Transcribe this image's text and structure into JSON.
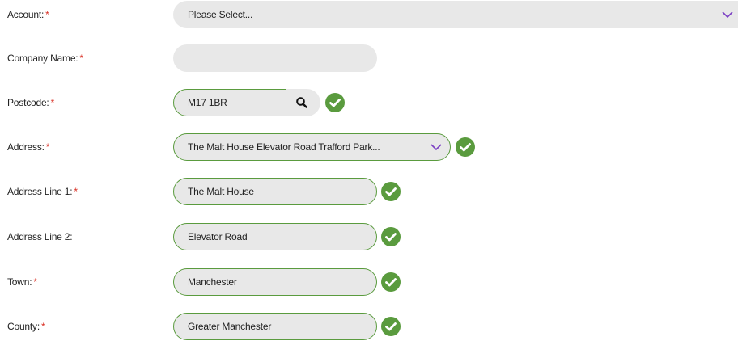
{
  "form": {
    "account": {
      "label": "Account:",
      "required": "*",
      "value": "Please Select..."
    },
    "company_name": {
      "label": "Company Name:",
      "required": "*",
      "value": ""
    },
    "postcode": {
      "label": "Postcode:",
      "required": "*",
      "value": "M17 1BR"
    },
    "address": {
      "label": "Address:",
      "required": "*",
      "value": "The Malt House Elevator Road Trafford Park..."
    },
    "address_line_1": {
      "label": "Address Line 1:",
      "required": "*",
      "value": "The Malt House"
    },
    "address_line_2": {
      "label": "Address Line 2:",
      "value": "Elevator Road"
    },
    "town": {
      "label": "Town:",
      "required": "*",
      "value": "Manchester"
    },
    "county": {
      "label": "County:",
      "required": "*",
      "value": "Greater Manchester"
    }
  },
  "icons": {
    "dropdown": "chevron-down-icon",
    "search": "search-icon",
    "valid": "check-circle-icon"
  },
  "colors": {
    "required_star": "#d93025",
    "valid_green": "#5a9b3e",
    "chevron": "#7b3fc4",
    "field_bg": "#e8e8e8"
  }
}
